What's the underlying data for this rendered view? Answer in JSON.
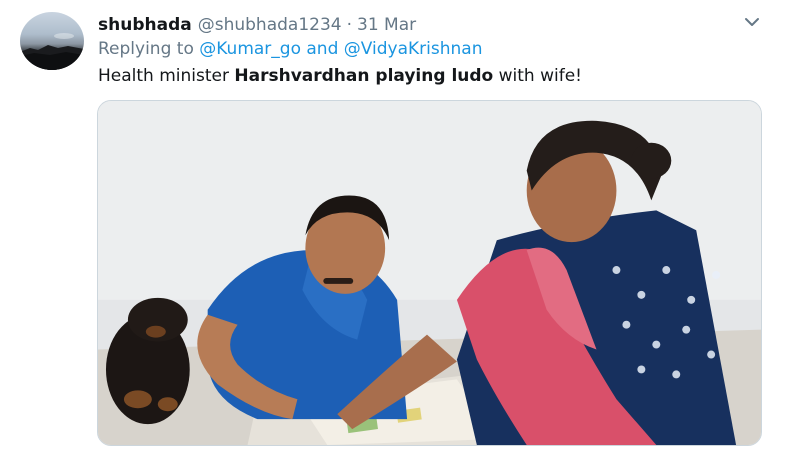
{
  "tweet": {
    "display_name": "shubhada",
    "handle": "@shubhada1234",
    "separator": "·",
    "date": "31 Mar",
    "replying_prefix": "Replying to",
    "reply_user_1": "@Kumar_go",
    "reply_and": "and",
    "reply_user_2": "@VidyaKrishnan",
    "text_part_1": "Health minister ",
    "text_bold": "Harshvardhan playing ludo",
    "text_part_2": " with wife!",
    "icons": {
      "more": "chevron-down-icon",
      "avatar": "landscape-avatar"
    },
    "colors": {
      "link": "#1b95e0",
      "muted": "#657786",
      "text": "#14171a",
      "card_border": "#ccd6dd"
    }
  }
}
